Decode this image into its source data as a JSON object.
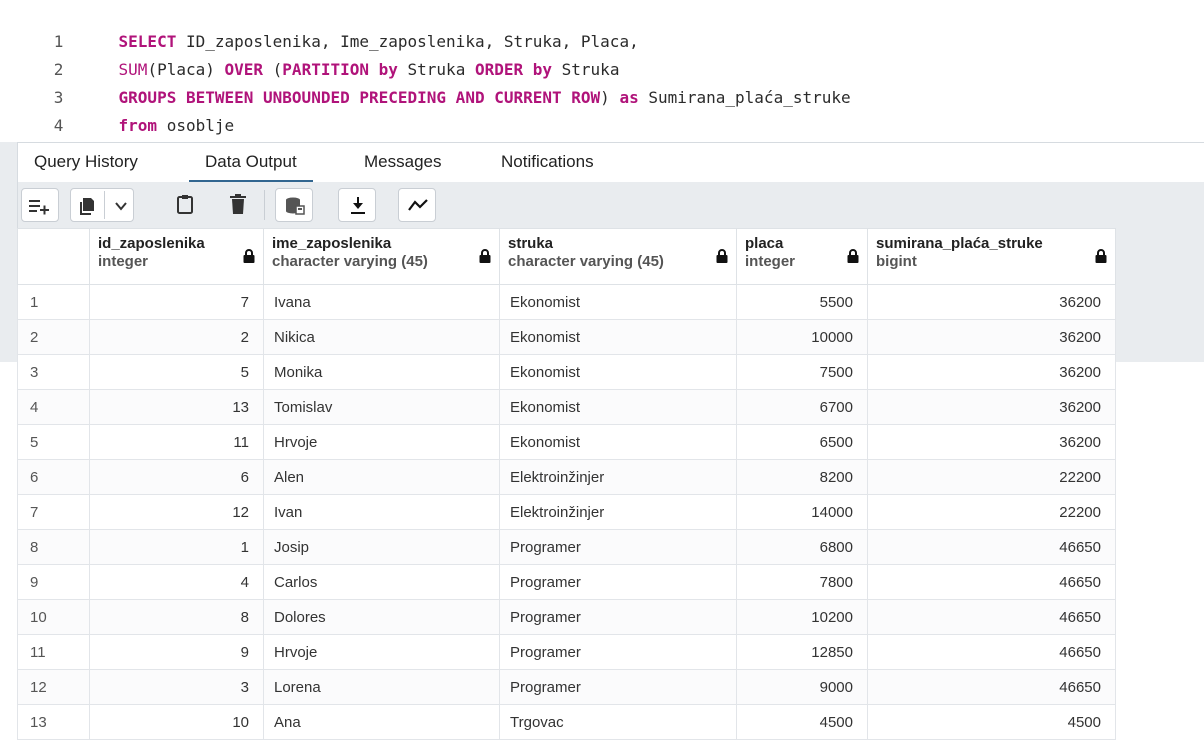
{
  "editor": {
    "lines": [
      {
        "num": "1",
        "segs": [
          {
            "t": "SELECT",
            "k": "kw"
          },
          {
            "t": " ID_zaposlenika, Ime_zaposlenika, Struka, Placa,",
            "k": ""
          }
        ]
      },
      {
        "num": "2",
        "segs": [
          {
            "t": "SUM",
            "k": "fn"
          },
          {
            "t": "(Placa) ",
            "k": ""
          },
          {
            "t": "OVER",
            "k": "kw"
          },
          {
            "t": " (",
            "k": ""
          },
          {
            "t": "PARTITION by",
            "k": "kw"
          },
          {
            "t": " Struka ",
            "k": ""
          },
          {
            "t": "ORDER by",
            "k": "kw"
          },
          {
            "t": " Struka",
            "k": ""
          }
        ]
      },
      {
        "num": "3",
        "segs": [
          {
            "t": "GROUPS BETWEEN UNBOUNDED PRECEDING AND CURRENT ROW",
            "k": "kw"
          },
          {
            "t": ") ",
            "k": ""
          },
          {
            "t": "as",
            "k": "kw"
          },
          {
            "t": " Sumirana_plaća_struke",
            "k": ""
          }
        ]
      },
      {
        "num": "4",
        "segs": [
          {
            "t": "from",
            "k": "kw"
          },
          {
            "t": " osoblje",
            "k": ""
          }
        ]
      }
    ]
  },
  "tabs": [
    "Query History",
    "Data Output",
    "Messages",
    "Notifications"
  ],
  "active_tab": "Data Output",
  "toolbar": {
    "icons": [
      "add-row-icon",
      "copy-icon",
      "chevron-down-icon",
      "paste-icon",
      "delete-icon",
      "save-data-icon",
      "download-icon",
      "graph-icon"
    ]
  },
  "colors": {
    "keyword": "#b0137a",
    "active_tab": "#326690"
  },
  "table": {
    "columns": [
      {
        "name": "id_zaposlenika",
        "type": "integer",
        "align": "right"
      },
      {
        "name": "ime_zaposlenika",
        "type": "character varying (45)",
        "align": "left"
      },
      {
        "name": "struka",
        "type": "character varying (45)",
        "align": "left"
      },
      {
        "name": "placa",
        "type": "integer",
        "align": "right"
      },
      {
        "name": "sumirana_plaća_struke",
        "type": "bigint",
        "align": "right"
      }
    ],
    "rows": [
      {
        "n": "1",
        "c": [
          "7",
          "Ivana",
          "Ekonomist",
          "5500",
          "36200"
        ]
      },
      {
        "n": "2",
        "c": [
          "2",
          "Nikica",
          "Ekonomist",
          "10000",
          "36200"
        ]
      },
      {
        "n": "3",
        "c": [
          "5",
          "Monika",
          "Ekonomist",
          "7500",
          "36200"
        ]
      },
      {
        "n": "4",
        "c": [
          "13",
          "Tomislav",
          "Ekonomist",
          "6700",
          "36200"
        ]
      },
      {
        "n": "5",
        "c": [
          "11",
          "Hrvoje",
          "Ekonomist",
          "6500",
          "36200"
        ]
      },
      {
        "n": "6",
        "c": [
          "6",
          "Alen",
          "Elektroinžinjer",
          "8200",
          "22200"
        ]
      },
      {
        "n": "7",
        "c": [
          "12",
          "Ivan",
          "Elektroinžinjer",
          "14000",
          "22200"
        ]
      },
      {
        "n": "8",
        "c": [
          "1",
          "Josip",
          "Programer",
          "6800",
          "46650"
        ]
      },
      {
        "n": "9",
        "c": [
          "4",
          "Carlos",
          "Programer",
          "7800",
          "46650"
        ]
      },
      {
        "n": "10",
        "c": [
          "8",
          "Dolores",
          "Programer",
          "10200",
          "46650"
        ]
      },
      {
        "n": "11",
        "c": [
          "9",
          "Hrvoje",
          "Programer",
          "12850",
          "46650"
        ]
      },
      {
        "n": "12",
        "c": [
          "3",
          "Lorena",
          "Programer",
          "9000",
          "46650"
        ]
      },
      {
        "n": "13",
        "c": [
          "10",
          "Ana",
          "Trgovac",
          "4500",
          "4500"
        ]
      }
    ]
  }
}
